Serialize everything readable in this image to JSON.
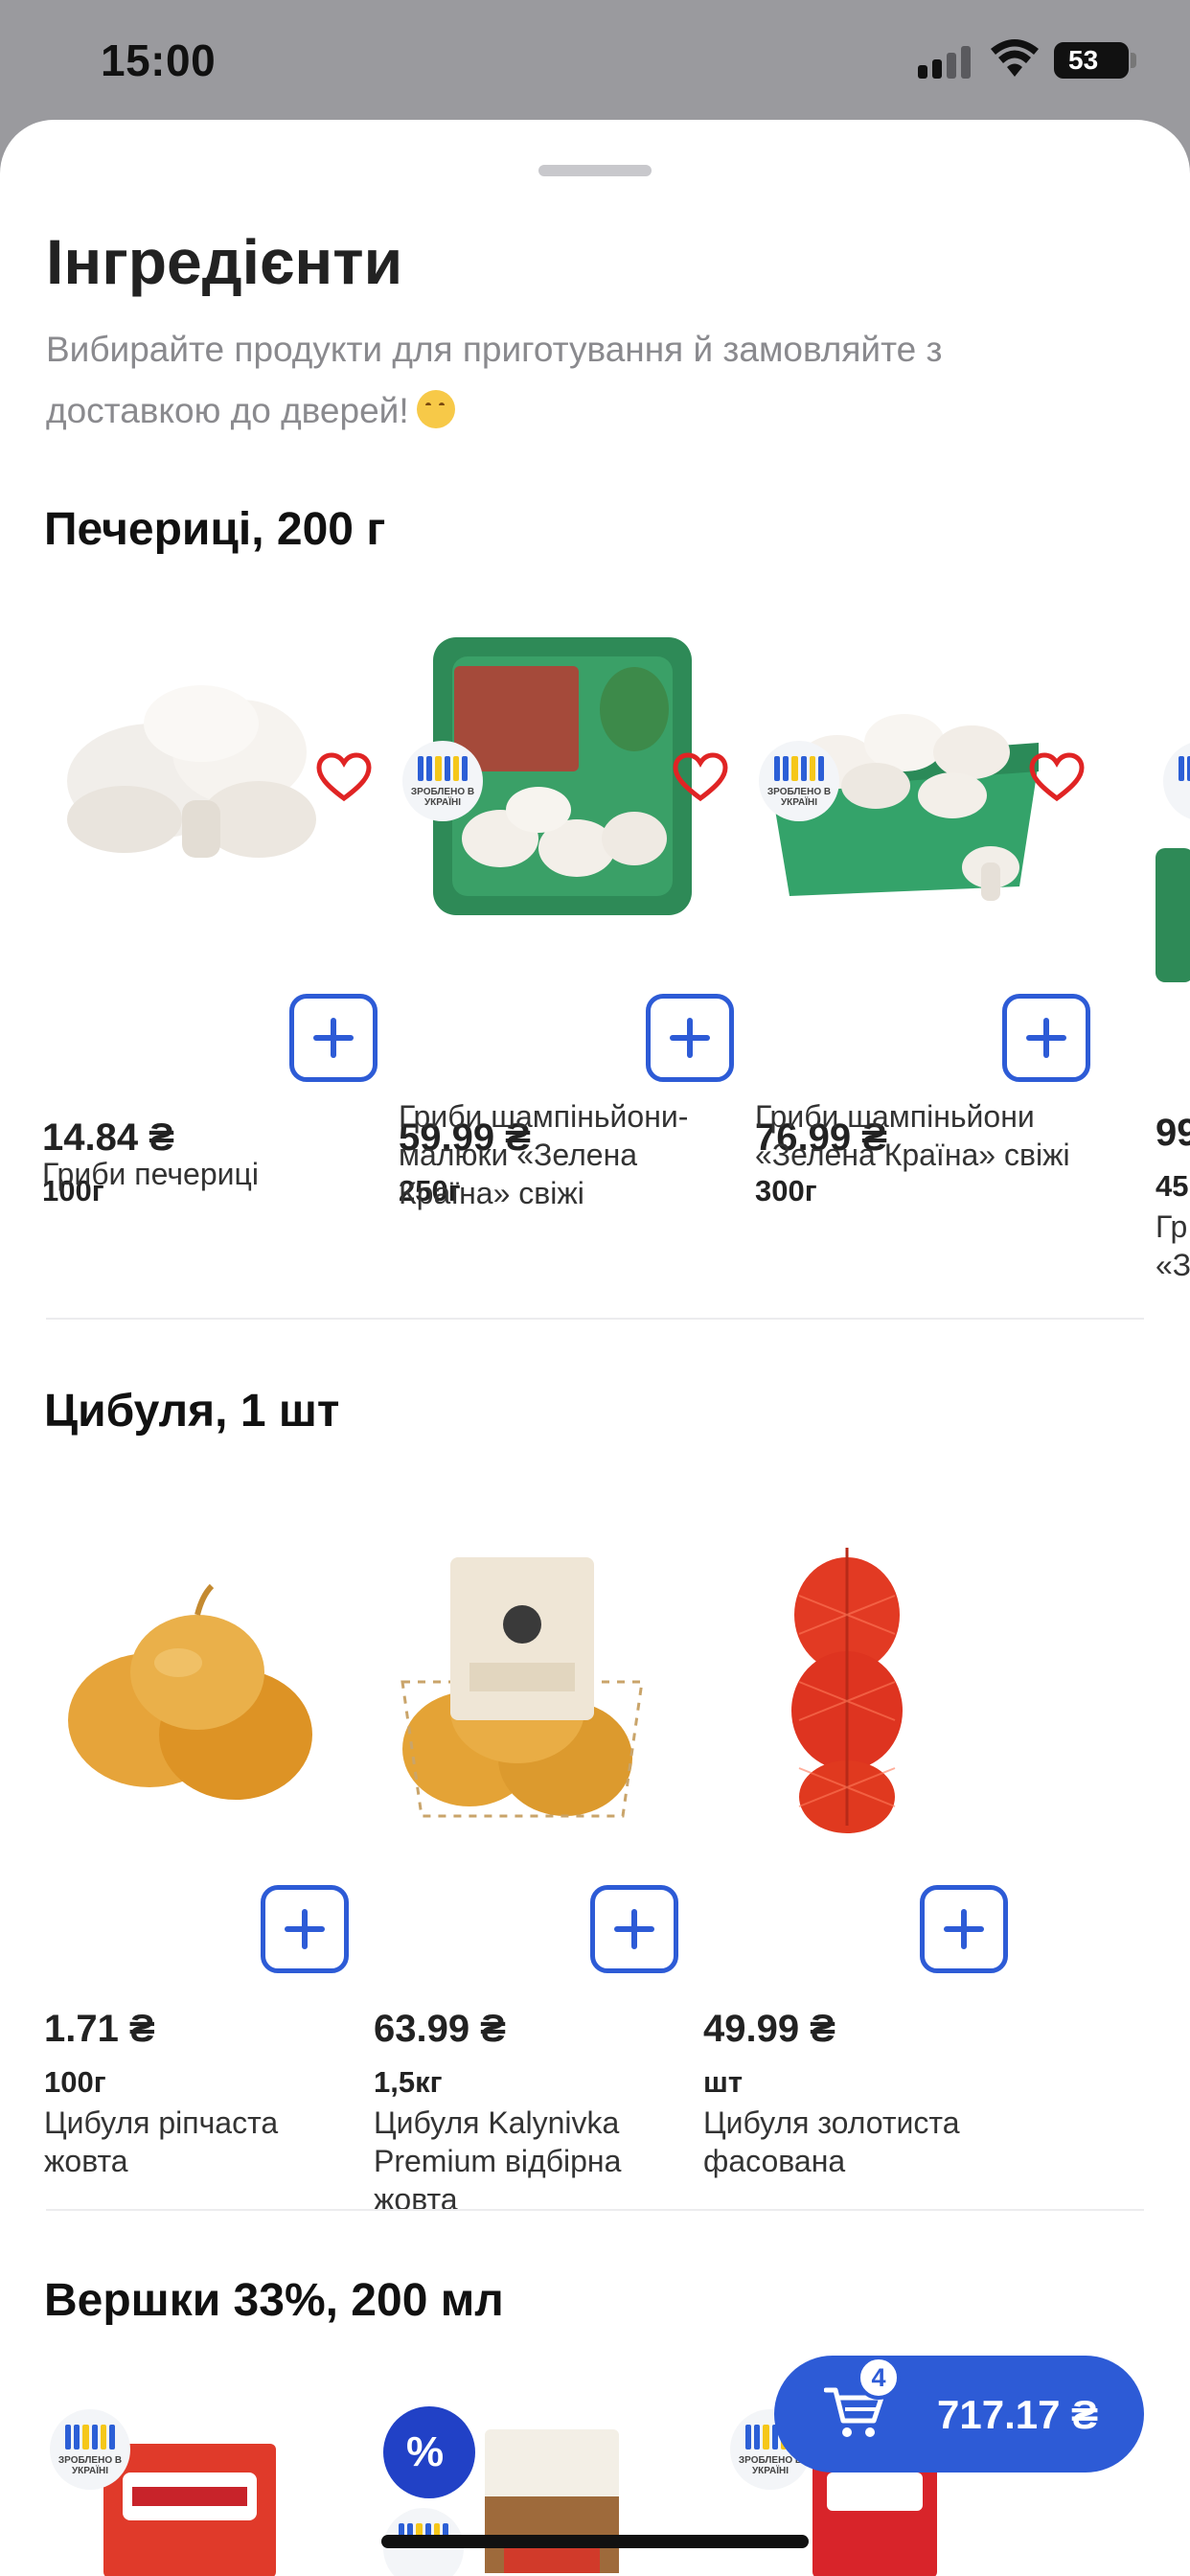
{
  "status_bar": {
    "time": "15:00",
    "battery": "53",
    "signal_bars_on": 2,
    "signal_bars_total": 4
  },
  "header": {
    "title": "Інгредієнти",
    "subtitle": "Вибирайте продукти для приготування й замовляйте з доставкою до дверей!",
    "subtitle_emoji": "smiling-face-emoji"
  },
  "ua_badge_text": "ЗРОБЛЕНО В УКРАЇНІ",
  "sections": [
    {
      "title": "Печериці, 200 г",
      "products": [
        {
          "price": "14.84 ₴",
          "weight": "100г",
          "name": "Гриби печериці"
        },
        {
          "price": "59.99 ₴",
          "weight": "250г",
          "name": "Гриби шампіньйони-малюки «Зелена Країна» свіжі"
        },
        {
          "price": "76.99 ₴",
          "weight": "300г",
          "name": "Гриби шампіньйони «Зелена Країна» свіжі"
        },
        {
          "price": "99",
          "weight": "45",
          "name": "Гр «З"
        }
      ]
    },
    {
      "title": "Цибуля, 1 шт",
      "products": [
        {
          "price": "1.71 ₴",
          "weight": "100г",
          "name": "Цибуля ріпчаста жовта"
        },
        {
          "price": "63.99 ₴",
          "weight": "1,5кг",
          "name": "Цибуля Kalynivka Premium відбірна жовта"
        },
        {
          "price": "49.99 ₴",
          "weight": "шт",
          "name": "Цибуля золотиста фасована"
        }
      ]
    },
    {
      "title": "Вершки 33%, 200 мл",
      "products": []
    }
  ],
  "cart": {
    "count": "4",
    "total": "717.17 ₴"
  },
  "colors": {
    "accent": "#2d5bd6",
    "heart": "#e02424",
    "ua_blue": "#2c5fd6",
    "ua_yellow": "#f5c71a"
  }
}
